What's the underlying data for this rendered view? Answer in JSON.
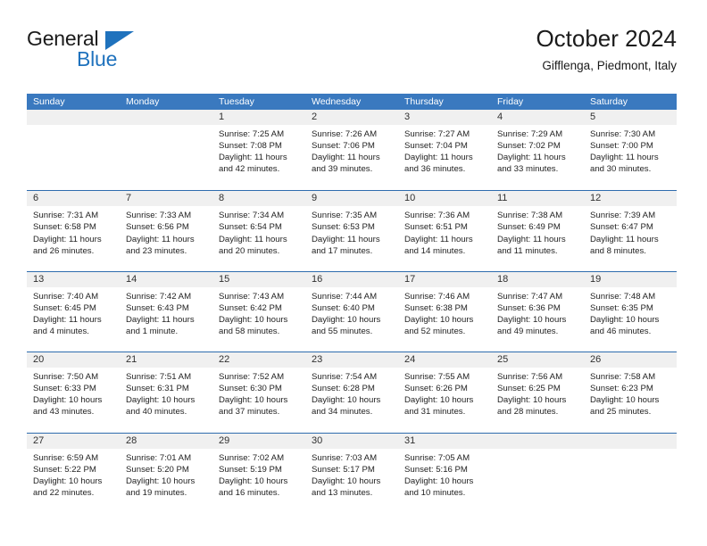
{
  "brand": {
    "name_top": "General",
    "name_bottom": "Blue",
    "accent_color": "#1f72bd",
    "triangle_icon": "brand-triangle-icon"
  },
  "header": {
    "title": "October 2024",
    "subtitle": "Gifflenga, Piedmont, Italy"
  },
  "theme": {
    "header_row_bg": "#3a79bf",
    "week_rule": "#2e6cae",
    "daynum_band_bg": "#f0f0f0",
    "text": "#232323"
  },
  "weekdays": [
    "Sunday",
    "Monday",
    "Tuesday",
    "Wednesday",
    "Thursday",
    "Friday",
    "Saturday"
  ],
  "labels": {
    "sunrise_prefix": "Sunrise:",
    "sunset_prefix": "Sunset:",
    "daylight_prefix": "Daylight:"
  },
  "weeks": [
    [
      {
        "day": "",
        "sunrise": "",
        "sunset": "",
        "daylight_line1": "",
        "daylight_line2": ""
      },
      {
        "day": "",
        "sunrise": "",
        "sunset": "",
        "daylight_line1": "",
        "daylight_line2": ""
      },
      {
        "day": "1",
        "sunrise": "Sunrise: 7:25 AM",
        "sunset": "Sunset: 7:08 PM",
        "daylight_line1": "Daylight: 11 hours",
        "daylight_line2": "and 42 minutes."
      },
      {
        "day": "2",
        "sunrise": "Sunrise: 7:26 AM",
        "sunset": "Sunset: 7:06 PM",
        "daylight_line1": "Daylight: 11 hours",
        "daylight_line2": "and 39 minutes."
      },
      {
        "day": "3",
        "sunrise": "Sunrise: 7:27 AM",
        "sunset": "Sunset: 7:04 PM",
        "daylight_line1": "Daylight: 11 hours",
        "daylight_line2": "and 36 minutes."
      },
      {
        "day": "4",
        "sunrise": "Sunrise: 7:29 AM",
        "sunset": "Sunset: 7:02 PM",
        "daylight_line1": "Daylight: 11 hours",
        "daylight_line2": "and 33 minutes."
      },
      {
        "day": "5",
        "sunrise": "Sunrise: 7:30 AM",
        "sunset": "Sunset: 7:00 PM",
        "daylight_line1": "Daylight: 11 hours",
        "daylight_line2": "and 30 minutes."
      }
    ],
    [
      {
        "day": "6",
        "sunrise": "Sunrise: 7:31 AM",
        "sunset": "Sunset: 6:58 PM",
        "daylight_line1": "Daylight: 11 hours",
        "daylight_line2": "and 26 minutes."
      },
      {
        "day": "7",
        "sunrise": "Sunrise: 7:33 AM",
        "sunset": "Sunset: 6:56 PM",
        "daylight_line1": "Daylight: 11 hours",
        "daylight_line2": "and 23 minutes."
      },
      {
        "day": "8",
        "sunrise": "Sunrise: 7:34 AM",
        "sunset": "Sunset: 6:54 PM",
        "daylight_line1": "Daylight: 11 hours",
        "daylight_line2": "and 20 minutes."
      },
      {
        "day": "9",
        "sunrise": "Sunrise: 7:35 AM",
        "sunset": "Sunset: 6:53 PM",
        "daylight_line1": "Daylight: 11 hours",
        "daylight_line2": "and 17 minutes."
      },
      {
        "day": "10",
        "sunrise": "Sunrise: 7:36 AM",
        "sunset": "Sunset: 6:51 PM",
        "daylight_line1": "Daylight: 11 hours",
        "daylight_line2": "and 14 minutes."
      },
      {
        "day": "11",
        "sunrise": "Sunrise: 7:38 AM",
        "sunset": "Sunset: 6:49 PM",
        "daylight_line1": "Daylight: 11 hours",
        "daylight_line2": "and 11 minutes."
      },
      {
        "day": "12",
        "sunrise": "Sunrise: 7:39 AM",
        "sunset": "Sunset: 6:47 PM",
        "daylight_line1": "Daylight: 11 hours",
        "daylight_line2": "and 8 minutes."
      }
    ],
    [
      {
        "day": "13",
        "sunrise": "Sunrise: 7:40 AM",
        "sunset": "Sunset: 6:45 PM",
        "daylight_line1": "Daylight: 11 hours",
        "daylight_line2": "and 4 minutes."
      },
      {
        "day": "14",
        "sunrise": "Sunrise: 7:42 AM",
        "sunset": "Sunset: 6:43 PM",
        "daylight_line1": "Daylight: 11 hours",
        "daylight_line2": "and 1 minute."
      },
      {
        "day": "15",
        "sunrise": "Sunrise: 7:43 AM",
        "sunset": "Sunset: 6:42 PM",
        "daylight_line1": "Daylight: 10 hours",
        "daylight_line2": "and 58 minutes."
      },
      {
        "day": "16",
        "sunrise": "Sunrise: 7:44 AM",
        "sunset": "Sunset: 6:40 PM",
        "daylight_line1": "Daylight: 10 hours",
        "daylight_line2": "and 55 minutes."
      },
      {
        "day": "17",
        "sunrise": "Sunrise: 7:46 AM",
        "sunset": "Sunset: 6:38 PM",
        "daylight_line1": "Daylight: 10 hours",
        "daylight_line2": "and 52 minutes."
      },
      {
        "day": "18",
        "sunrise": "Sunrise: 7:47 AM",
        "sunset": "Sunset: 6:36 PM",
        "daylight_line1": "Daylight: 10 hours",
        "daylight_line2": "and 49 minutes."
      },
      {
        "day": "19",
        "sunrise": "Sunrise: 7:48 AM",
        "sunset": "Sunset: 6:35 PM",
        "daylight_line1": "Daylight: 10 hours",
        "daylight_line2": "and 46 minutes."
      }
    ],
    [
      {
        "day": "20",
        "sunrise": "Sunrise: 7:50 AM",
        "sunset": "Sunset: 6:33 PM",
        "daylight_line1": "Daylight: 10 hours",
        "daylight_line2": "and 43 minutes."
      },
      {
        "day": "21",
        "sunrise": "Sunrise: 7:51 AM",
        "sunset": "Sunset: 6:31 PM",
        "daylight_line1": "Daylight: 10 hours",
        "daylight_line2": "and 40 minutes."
      },
      {
        "day": "22",
        "sunrise": "Sunrise: 7:52 AM",
        "sunset": "Sunset: 6:30 PM",
        "daylight_line1": "Daylight: 10 hours",
        "daylight_line2": "and 37 minutes."
      },
      {
        "day": "23",
        "sunrise": "Sunrise: 7:54 AM",
        "sunset": "Sunset: 6:28 PM",
        "daylight_line1": "Daylight: 10 hours",
        "daylight_line2": "and 34 minutes."
      },
      {
        "day": "24",
        "sunrise": "Sunrise: 7:55 AM",
        "sunset": "Sunset: 6:26 PM",
        "daylight_line1": "Daylight: 10 hours",
        "daylight_line2": "and 31 minutes."
      },
      {
        "day": "25",
        "sunrise": "Sunrise: 7:56 AM",
        "sunset": "Sunset: 6:25 PM",
        "daylight_line1": "Daylight: 10 hours",
        "daylight_line2": "and 28 minutes."
      },
      {
        "day": "26",
        "sunrise": "Sunrise: 7:58 AM",
        "sunset": "Sunset: 6:23 PM",
        "daylight_line1": "Daylight: 10 hours",
        "daylight_line2": "and 25 minutes."
      }
    ],
    [
      {
        "day": "27",
        "sunrise": "Sunrise: 6:59 AM",
        "sunset": "Sunset: 5:22 PM",
        "daylight_line1": "Daylight: 10 hours",
        "daylight_line2": "and 22 minutes."
      },
      {
        "day": "28",
        "sunrise": "Sunrise: 7:01 AM",
        "sunset": "Sunset: 5:20 PM",
        "daylight_line1": "Daylight: 10 hours",
        "daylight_line2": "and 19 minutes."
      },
      {
        "day": "29",
        "sunrise": "Sunrise: 7:02 AM",
        "sunset": "Sunset: 5:19 PM",
        "daylight_line1": "Daylight: 10 hours",
        "daylight_line2": "and 16 minutes."
      },
      {
        "day": "30",
        "sunrise": "Sunrise: 7:03 AM",
        "sunset": "Sunset: 5:17 PM",
        "daylight_line1": "Daylight: 10 hours",
        "daylight_line2": "and 13 minutes."
      },
      {
        "day": "31",
        "sunrise": "Sunrise: 7:05 AM",
        "sunset": "Sunset: 5:16 PM",
        "daylight_line1": "Daylight: 10 hours",
        "daylight_line2": "and 10 minutes."
      },
      {
        "day": "",
        "sunrise": "",
        "sunset": "",
        "daylight_line1": "",
        "daylight_line2": ""
      },
      {
        "day": "",
        "sunrise": "",
        "sunset": "",
        "daylight_line1": "",
        "daylight_line2": ""
      }
    ]
  ]
}
